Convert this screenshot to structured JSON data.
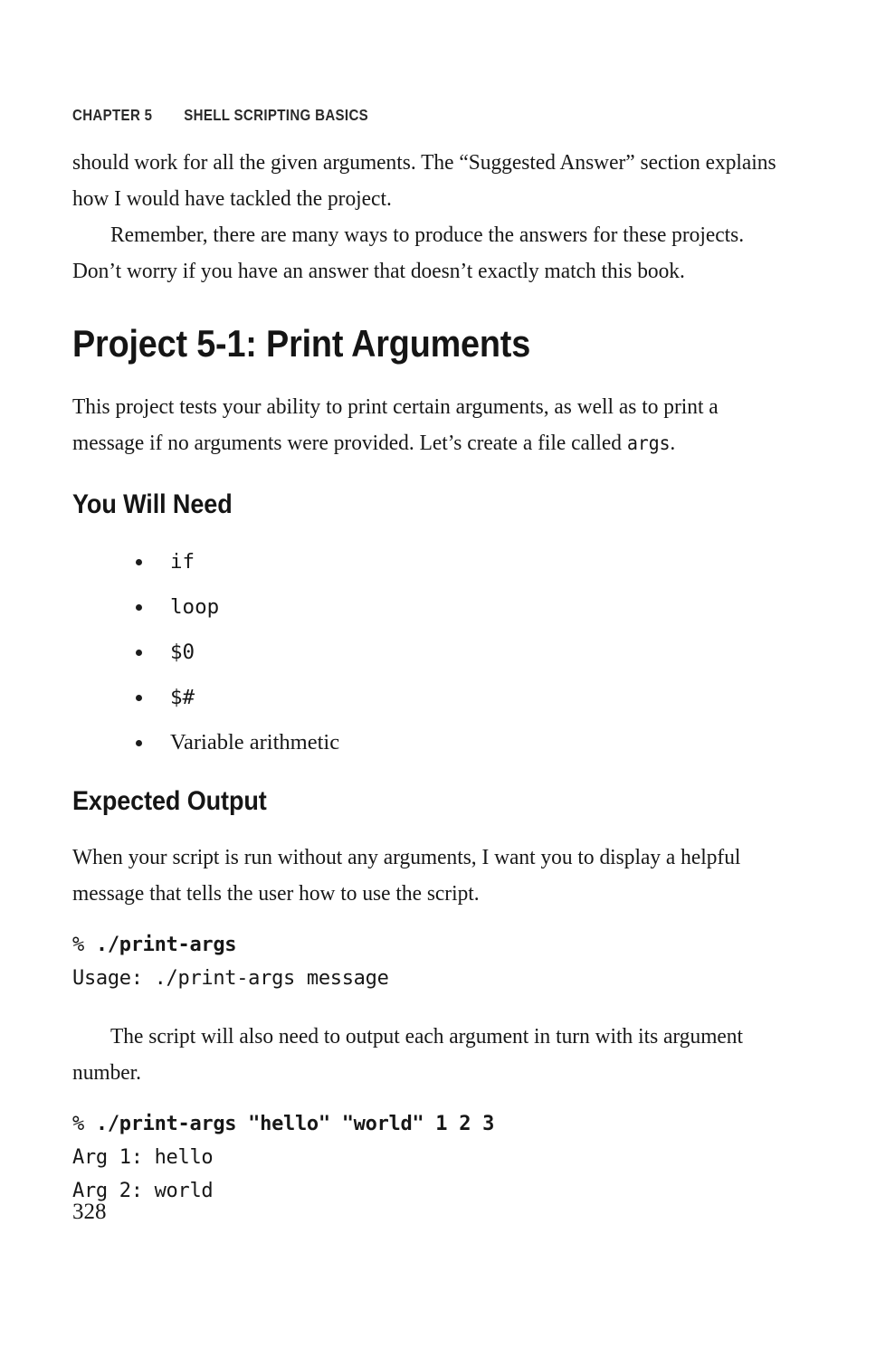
{
  "running_head": {
    "chapter": "CHAPTER 5",
    "title": "SHELL SCRIPTING BASICS"
  },
  "intro": {
    "para1": "should work for all the given arguments. The “Suggested Answer” section explains how I would have tackled the project.",
    "para2": "Remember, there are many ways to produce the answers for these projects. Don’t worry if you have an answer that doesn’t exactly match this book."
  },
  "project": {
    "heading": "Project 5-1: Print Arguments",
    "description_before_code": "This project tests your ability to print certain arguments, as well as to print a message if no arguments were provided. Let’s create a file called ",
    "description_code": "args",
    "description_after_code": "."
  },
  "you_will_need": {
    "heading": "You Will Need",
    "items": [
      {
        "label": "if",
        "style": "mono"
      },
      {
        "label": "loop",
        "style": "mono"
      },
      {
        "label": "$0",
        "style": "mono"
      },
      {
        "label": "$#",
        "style": "mono"
      },
      {
        "label": "Variable arithmetic",
        "style": "text"
      }
    ]
  },
  "expected_output": {
    "heading": "Expected Output",
    "para1": "When your script is run without any arguments, I want you to display a helpful message that tells the user how to use the script.",
    "block1": {
      "prompt": "% ",
      "command": "./print-args",
      "output_lines": [
        "Usage: ./print-args message"
      ]
    },
    "para2": "The script will also need to output each argument in turn with its argument number.",
    "block2": {
      "prompt": "% ",
      "command": "./print-args \"hello\" \"world\" 1 2 3",
      "output_lines": [
        "Arg 1: hello",
        "Arg 2: world"
      ]
    }
  },
  "folio": {
    "page_number": "328"
  },
  "colors": {
    "text": "#171717",
    "heading": "#151515",
    "background": "#ffffff"
  }
}
